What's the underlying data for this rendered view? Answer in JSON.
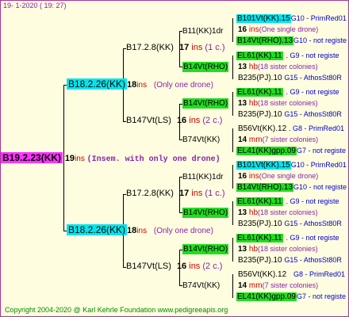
{
  "header": {
    "date": "19-   1-2020  ( 19:  27)"
  },
  "root": {
    "label": "B19.2.23(KK)",
    "num": "19",
    "suffix": "ins",
    "note": "(Insem. with only one drone)"
  },
  "queens": {
    "g1a": {
      "label": "B18.2.26(KK)",
      "num": "18",
      "suffix": "ins",
      "note": "(Only one drone)"
    },
    "g1b": {
      "label": "B18.2.26(KK)",
      "num": "18",
      "suffix": "ins",
      "note": "(Only one drone)"
    },
    "g2a": {
      "label": "B17.2.8(KK)",
      "num": "17",
      "suffix": "ins",
      "note": "(1 c.)"
    },
    "g2b": {
      "label": "B147Vt(LS)",
      "num": "16",
      "suffix": "ins",
      "note": "(2 c.)"
    },
    "g2c": {
      "label": "B17.2.8(KK)",
      "num": "17",
      "suffix": "ins",
      "note": "(1 c.)"
    },
    "g2d": {
      "label": "B147Vt(LS)",
      "num": "16",
      "suffix": "ins",
      "note": "(2 c.)"
    },
    "g3a": {
      "label": "B11(KK)1dr",
      "num": "16",
      "suffix": "ins",
      "note": "(One single drone)"
    },
    "g3b": {
      "label": "B14Vt(RHO)",
      "num": "13",
      "suffix": "hb",
      "note": "(18 sister colonies)"
    },
    "g3c": {
      "label": "B14Vt(RHO)",
      "num": "13",
      "suffix": "hb",
      "note": "(18 sister colonies)"
    },
    "g3d": {
      "label": "B74Vt(KK)",
      "num": "14",
      "suffix": "mm",
      "note": "(7 sister colonies)"
    },
    "g3e": {
      "label": "B11(KK)1dr",
      "num": "16",
      "suffix": "ins",
      "note": "(One single drone)"
    },
    "g3f": {
      "label": "B14Vt(RHO)",
      "num": "13",
      "suffix": "hb",
      "note": "(18 sister colonies)"
    },
    "g3g": {
      "label": "B14Vt(RHO)",
      "num": "13",
      "suffix": "hb",
      "note": "(18 sister colonies)"
    },
    "g3h": {
      "label": "B74Vt(KK)",
      "num": "14",
      "suffix": "mm",
      "note": "(7 sister colonies)"
    }
  },
  "g4": [
    {
      "label": "B101Vt(KK).15",
      "gen": "G10 - PrimRed01"
    },
    {
      "label": "B14Vt(RHO).13",
      "gen": "G10 - not registe"
    },
    {
      "label": "EL61(KK).11",
      "gen": ". G9 - not registe"
    },
    {
      "label": "B235(PJ).10",
      "gen": "G15 - AthosSt80R"
    },
    {
      "label": "EL61(KK).11",
      "gen": ". G9 - not registe"
    },
    {
      "label": "B235(PJ).10",
      "gen": "G15 - AthosSt80R"
    },
    {
      "label": "B56Vt(KK).12",
      "gen": ". G8 - PrimRed01"
    },
    {
      "label": "EL41(KK)gpp.09",
      "gen": "G7 - not registe"
    },
    {
      "label": "B101Vt(KK).15",
      "gen": "G10 - PrimRed01"
    },
    {
      "label": "B14Vt(RHO).13",
      "gen": "G10 - not registe"
    },
    {
      "label": "EL61(KK).11",
      "gen": ". G9 - not registe"
    },
    {
      "label": "B235(PJ).10",
      "gen": "G15 - AthosSt80R"
    },
    {
      "label": "EL61(KK).11",
      "gen": ". G9 - not registe"
    },
    {
      "label": "B235(PJ).10",
      "gen": "G15 - AthosSt80R"
    },
    {
      "label": "B56Vt(KK).12",
      "gen": "G8 - PrimRed01"
    },
    {
      "label": "EL41(KK)gpp.09",
      "gen": "G7 - not registe"
    }
  ],
  "footer": {
    "copyright": "Copyright 2004-2020 @ Karl Kehrle Foundation     www.pedigreeapis.org"
  }
}
